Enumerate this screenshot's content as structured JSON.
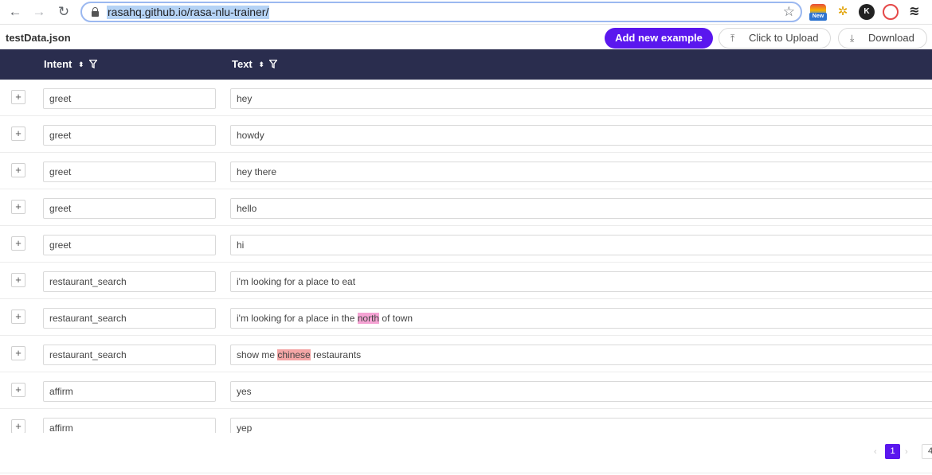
{
  "browser": {
    "url": "rasahq.github.io/rasa-nlu-trainer/",
    "back_glyph": "←",
    "forward_glyph": "→",
    "reload_glyph": "↻",
    "star_glyph": "☆",
    "extensions": [
      {
        "name": "rainbow-extension-icon",
        "badge": "New"
      },
      {
        "name": "bug-extension-icon",
        "glyph": "✲"
      },
      {
        "name": "k-extension-icon",
        "glyph": "K"
      },
      {
        "name": "target-extension-icon",
        "glyph": "◎"
      },
      {
        "name": "layers-extension-icon",
        "glyph": "≋"
      }
    ]
  },
  "toolbar": {
    "file_name": "testData.json",
    "add_label": "Add new example",
    "upload_label": "Click to Upload",
    "download_label": "Download",
    "upload_glyph": "⤒",
    "download_glyph": "⤓"
  },
  "table": {
    "columns": [
      {
        "label": "Intent"
      },
      {
        "label": "Text"
      }
    ],
    "expand_glyph": "+",
    "sort_glyph": "⬍",
    "rows": [
      {
        "intent": "greet",
        "text": [
          {
            "t": "hey"
          }
        ]
      },
      {
        "intent": "greet",
        "text": [
          {
            "t": "howdy"
          }
        ]
      },
      {
        "intent": "greet",
        "text": [
          {
            "t": "hey there"
          }
        ]
      },
      {
        "intent": "greet",
        "text": [
          {
            "t": "hello"
          }
        ]
      },
      {
        "intent": "greet",
        "text": [
          {
            "t": "hi"
          }
        ]
      },
      {
        "intent": "restaurant_search",
        "text": [
          {
            "t": "i'm looking for a place to eat"
          }
        ]
      },
      {
        "intent": "restaurant_search",
        "text": [
          {
            "t": "i'm looking for a place in the "
          },
          {
            "t": "north",
            "entity": "pink"
          },
          {
            "t": " of town"
          }
        ]
      },
      {
        "intent": "restaurant_search",
        "text": [
          {
            "t": "show me "
          },
          {
            "t": "chinese",
            "entity": "red"
          },
          {
            "t": " restaurants"
          }
        ]
      },
      {
        "intent": "affirm",
        "text": [
          {
            "t": "yes"
          }
        ]
      },
      {
        "intent": "affirm",
        "text": [
          {
            "t": "yep"
          }
        ]
      }
    ]
  },
  "pagination": {
    "prev_glyph": "‹",
    "current": "1",
    "next_glyph": "›",
    "last": "4"
  },
  "colors": {
    "primary": "#5a17ee",
    "header_bg": "#2a2d4e",
    "entity_pink": "#f5a3d4",
    "entity_red": "#f4a6a6"
  }
}
